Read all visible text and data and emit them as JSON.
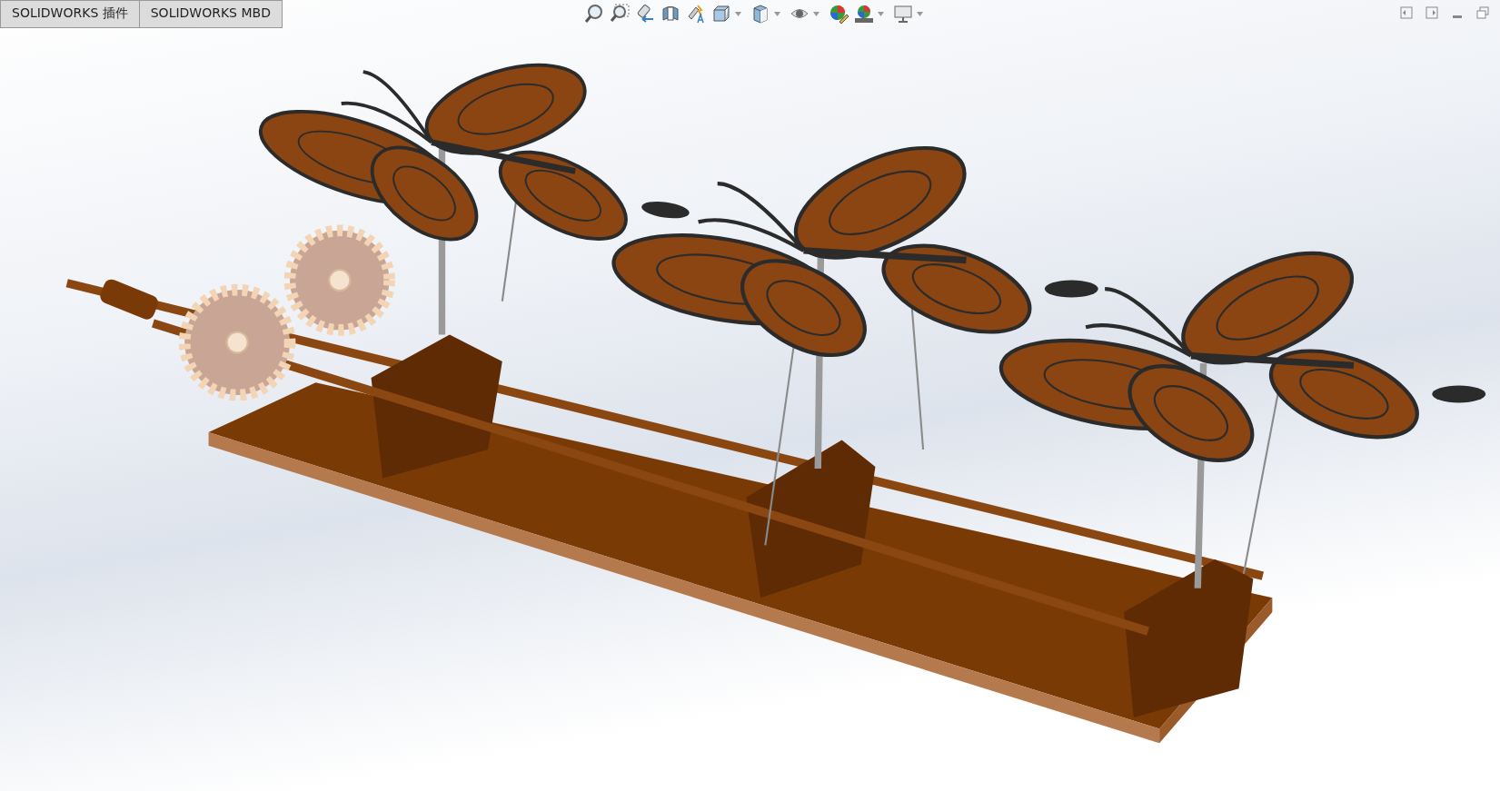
{
  "tabs": [
    {
      "label": "SOLIDWORKS 插件",
      "selected": false
    },
    {
      "label": "SOLIDWORKS MBD",
      "selected": false
    }
  ]
}
